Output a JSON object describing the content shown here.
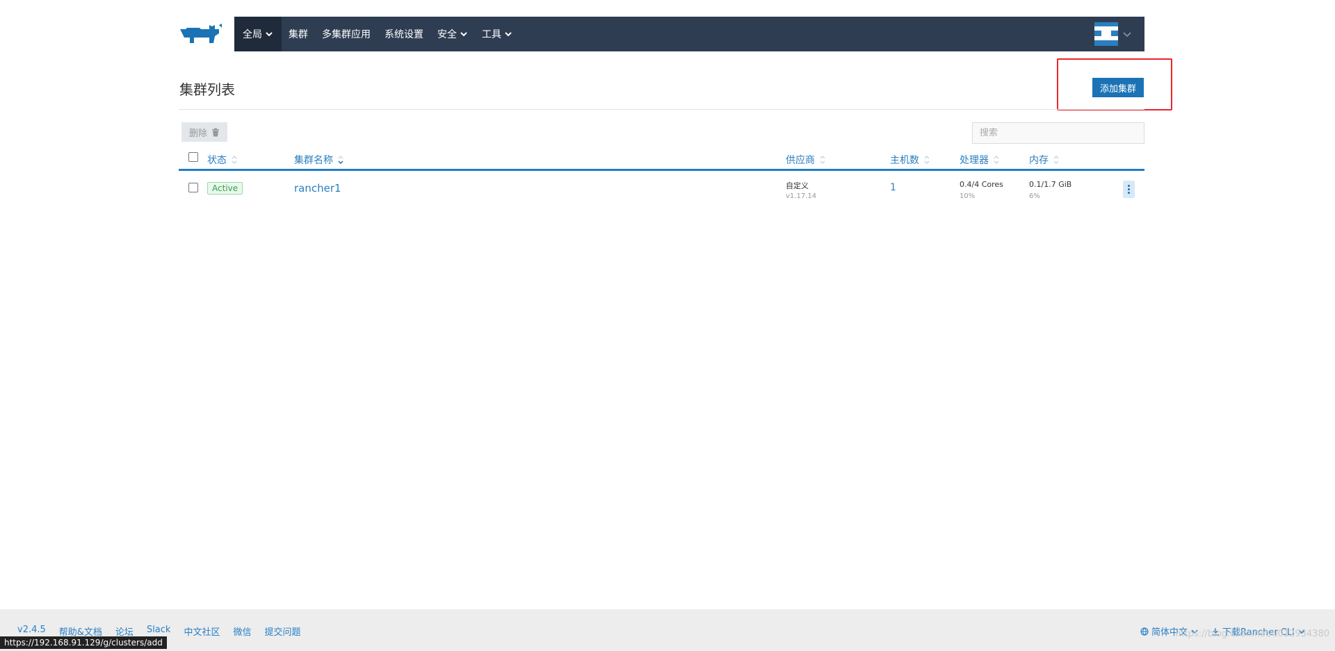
{
  "nav": {
    "items": [
      {
        "label": "全局",
        "dropdown": true,
        "active": true
      },
      {
        "label": "集群",
        "dropdown": false
      },
      {
        "label": "多集群应用",
        "dropdown": false
      },
      {
        "label": "系统设置",
        "dropdown": false
      },
      {
        "label": "安全",
        "dropdown": true
      },
      {
        "label": "工具",
        "dropdown": true
      }
    ]
  },
  "page": {
    "title": "集群列表",
    "add_button": "添加集群",
    "delete_button": "删除",
    "search_placeholder": "搜索"
  },
  "table": {
    "headers": {
      "state": "状态",
      "name": "集群名称",
      "provider": "供应商",
      "nodes": "主机数",
      "cpu": "处理器",
      "memory": "内存"
    },
    "rows": [
      {
        "state": "Active",
        "name": "rancher1",
        "provider": "自定义",
        "version": "v1.17.14",
        "nodes": "1",
        "cpu": "0.4/4 Cores",
        "cpu_pct": "10%",
        "memory": "0.1/1.7 GiB",
        "memory_pct": "6%"
      }
    ]
  },
  "footer": {
    "version": "v2.4.5",
    "links": [
      "帮助&文档",
      "论坛",
      "Slack",
      "中文社区",
      "微信",
      "提交问题"
    ],
    "language": "简体中文",
    "download": "下载Rancher CLI",
    "watermark": "https://blog.csdn.net/u012934380"
  },
  "status_bar_url": "https://192.168.91.129/g/clusters/add",
  "colors": {
    "nav_bg": "#2f3d52",
    "primary": "#1b73b5",
    "link": "#2a7fc1",
    "highlight": "#e8242b",
    "active_badge": "#37a04a"
  }
}
